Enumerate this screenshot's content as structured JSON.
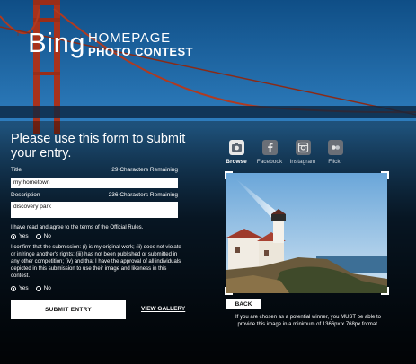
{
  "brand": {
    "logo": "Bing",
    "line1": "HOMEPAGE",
    "line2": "PHOTO CONTEST"
  },
  "form": {
    "heading": "Please use this form to submit your entry.",
    "title_label": "Title",
    "title_remaining": "29 Characters Remaining",
    "title_value": "my hometown",
    "description_label": "Description",
    "description_remaining": "236 Characters Remaining",
    "description_value": "discovery park",
    "terms_prefix": "I have read and agree to the terms of the",
    "terms_link": "Official Rules",
    "terms_suffix": ".",
    "yes": "Yes",
    "no": "No",
    "confirm_text": "I confirm that the submission: (i) is my original work; (ii) does not violate or infringe another's rights; (iii) has not been published or submitted in any other competition; (iv) and that I have the approval of all individuals depicted in this submission to use their image and likeness in this contest.",
    "submit": "SUBMIT ENTRY",
    "gallery": "VIEW GALLERY"
  },
  "sources": [
    {
      "label": "Browse",
      "icon": "browse-icon"
    },
    {
      "label": "Facebook",
      "icon": "facebook-icon"
    },
    {
      "label": "Instagram",
      "icon": "instagram-icon"
    },
    {
      "label": "Flickr",
      "icon": "flickr-icon"
    }
  ],
  "preview": {
    "back": "BACK",
    "notice": "If you are chosen as a potential winner, you MUST be able to provide this image in a minimum of 1366px x 768px format."
  }
}
